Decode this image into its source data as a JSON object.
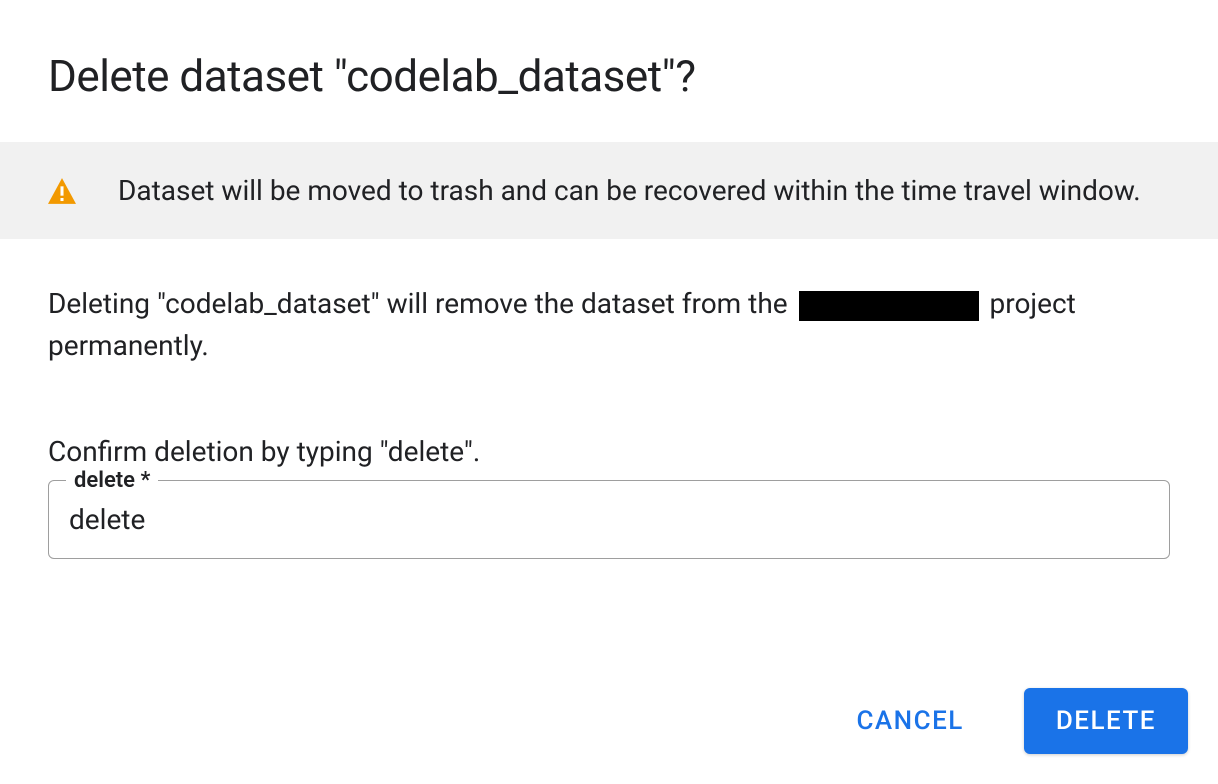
{
  "dialog": {
    "title": "Delete dataset \"codelab_dataset\"?",
    "banner": {
      "icon": "warning-icon",
      "text": "Dataset will be moved to trash and can be recovered within the time travel window."
    },
    "body": {
      "text_before_redacted": "Deleting \"codelab_dataset\" will remove the dataset from the ",
      "text_after_redacted": " project permanently."
    },
    "confirm": {
      "instruction": "Confirm deletion by typing \"delete\".",
      "input_label": "delete *",
      "input_value": "delete"
    },
    "actions": {
      "cancel_label": "CANCEL",
      "delete_label": "DELETE"
    }
  },
  "colors": {
    "warning": "#f29900",
    "primary": "#1a73e8",
    "banner_bg": "#f1f1f1"
  }
}
